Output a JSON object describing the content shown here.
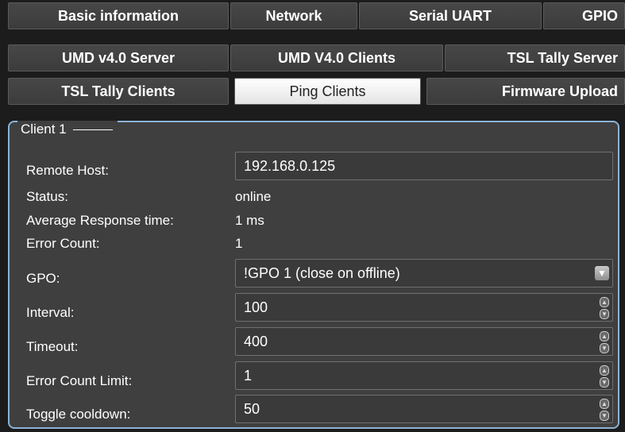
{
  "tabs": {
    "row1": [
      "Basic information",
      "Network",
      "Serial UART",
      "GPIO"
    ],
    "row2": [
      "UMD v4.0 Server",
      "UMD V4.0 Clients",
      "TSL Tally Server"
    ],
    "row3": [
      "TSL Tally Clients",
      "Ping Clients",
      "Firmware Upload"
    ],
    "active": "Ping Clients"
  },
  "client": {
    "legend": "Client 1",
    "remote_host_label": "Remote Host:",
    "remote_host_value": "192.168.0.125",
    "status_label": "Status:",
    "status_value": "online",
    "avg_label": "Average Response time:",
    "avg_value": "1 ms",
    "error_count_label": "Error Count:",
    "error_count_value": "1",
    "gpo_label": "GPO:",
    "gpo_value": "!GPO 1 (close on offline)",
    "interval_label": "Interval:",
    "interval_value": "100",
    "timeout_label": "Timeout:",
    "timeout_value": "400",
    "error_limit_label": "Error Count Limit:",
    "error_limit_value": "1",
    "cooldown_label": "Toggle cooldown:",
    "cooldown_value": "50"
  },
  "icons": {
    "dropdown": "chevron-down-icon",
    "spinner": "spinner-arrows-icon"
  },
  "colors": {
    "panel_border": "#8ab3d6",
    "background": "#1c1c1c",
    "panel": "#3f3f3f"
  }
}
